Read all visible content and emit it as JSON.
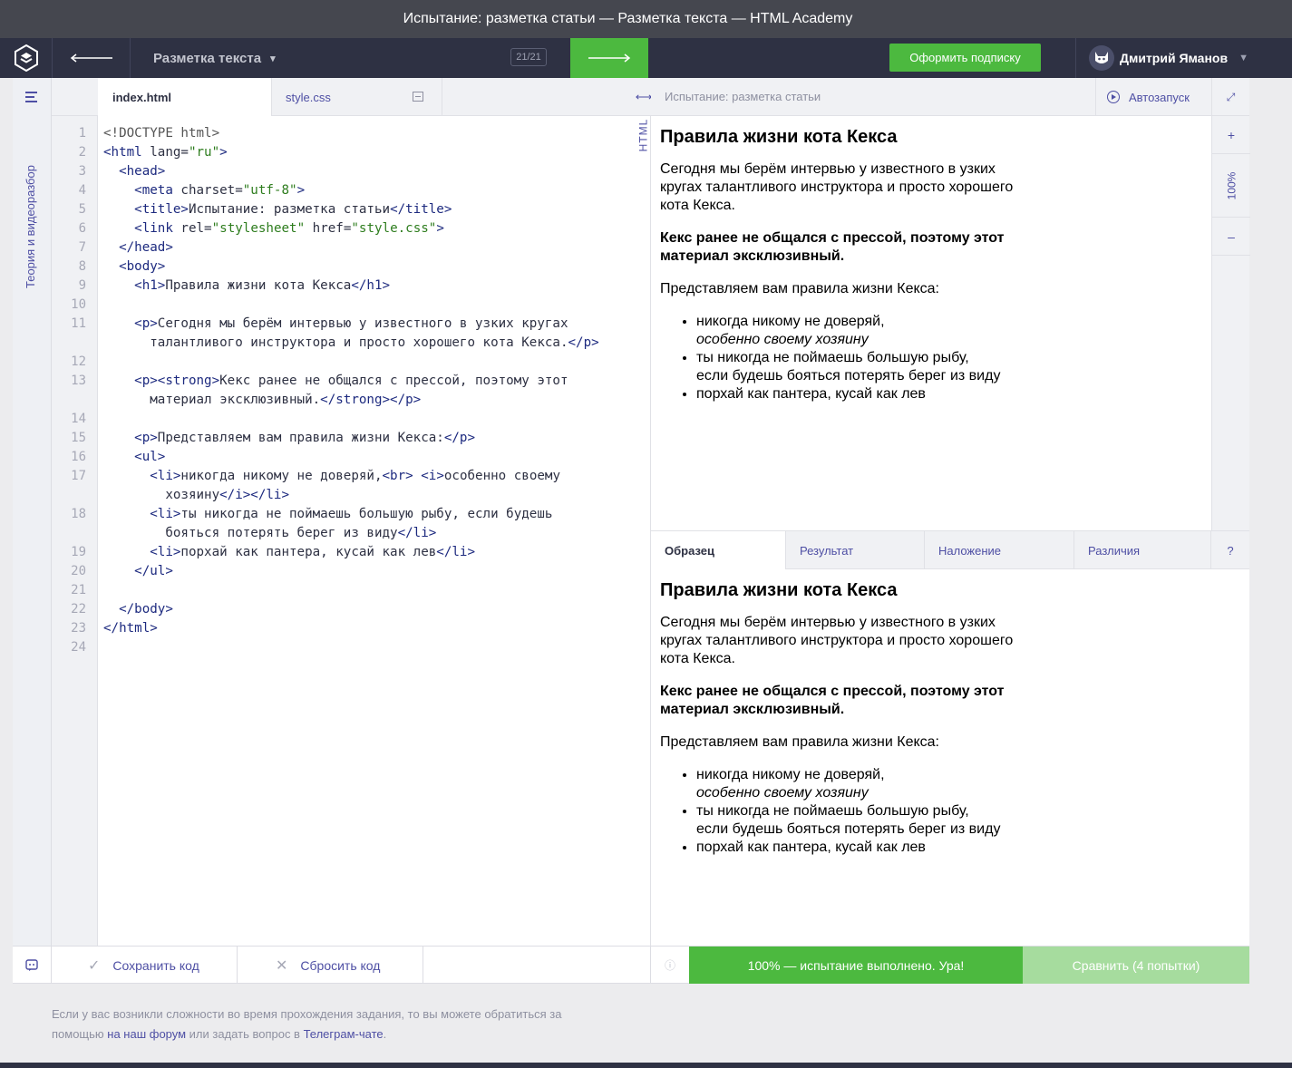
{
  "window": {
    "title": "Испытание: разметка статьи — Разметка текста — HTML Academy"
  },
  "nav": {
    "course_label": "Разметка текста",
    "counter": "21/21",
    "subscribe_label": "Оформить подписку",
    "user_name": "Дмитрий Яманов"
  },
  "sidebar": {
    "label": "Теория и видеоразбор"
  },
  "editor": {
    "tabs": [
      "index.html",
      "style.css"
    ],
    "language": "HTML",
    "line_numbers": [
      "1",
      "2",
      "3",
      "4",
      "5",
      "6",
      "7",
      "8",
      "9",
      "10",
      "11",
      "",
      "12",
      "13",
      "",
      "14",
      "15",
      "16",
      "17",
      "",
      "18",
      "",
      "19",
      "20",
      "21",
      "22",
      "23",
      "24"
    ]
  },
  "preview": {
    "title": "Испытание: разметка статьи",
    "autorun_label": "Автозапуск",
    "zoom": "100%",
    "zoom_plus": "+",
    "zoom_minus": "–",
    "h1": "Правила жизни кота Кекса",
    "p1": "Сегодня мы берём интервью у известного в узких кругах талантливого инструктора и просто хорошего кота Кекса.",
    "p2": "Кекс ранее не общался с прессой, поэтому этот материал эксклюзивный.",
    "p3": "Представляем вам правила жизни Кекса:",
    "li1a": "никогда никому не доверяй,",
    "li1b": "особенно своему хозяину",
    "li2a": "ты никогда не поймаешь большую рыбу,",
    "li2b": "если будешь бояться потерять берег из виду",
    "li3": "порхай как пантера, кусай как лев"
  },
  "compare_tabs": [
    "Образец",
    "Результат",
    "Наложение",
    "Различия",
    "?"
  ],
  "bottom": {
    "save_label": "Сохранить код",
    "reset_label": "Сбросить код",
    "result_label": "100% — испытание выполнено. Ура!",
    "compare_label": "Сравнить (4 попытки)"
  },
  "footer": {
    "text1": "Если у вас возникли сложности во время прохождения задания, то вы можете обратиться за помощью ",
    "link1": "на наш форум",
    "text2": " или задать вопрос в ",
    "link2": "Телеграм-чате",
    "text3": "."
  },
  "colors": {
    "accent": "#4e4fa4",
    "success": "#4cb93f",
    "nav_bg": "#2e3143"
  }
}
